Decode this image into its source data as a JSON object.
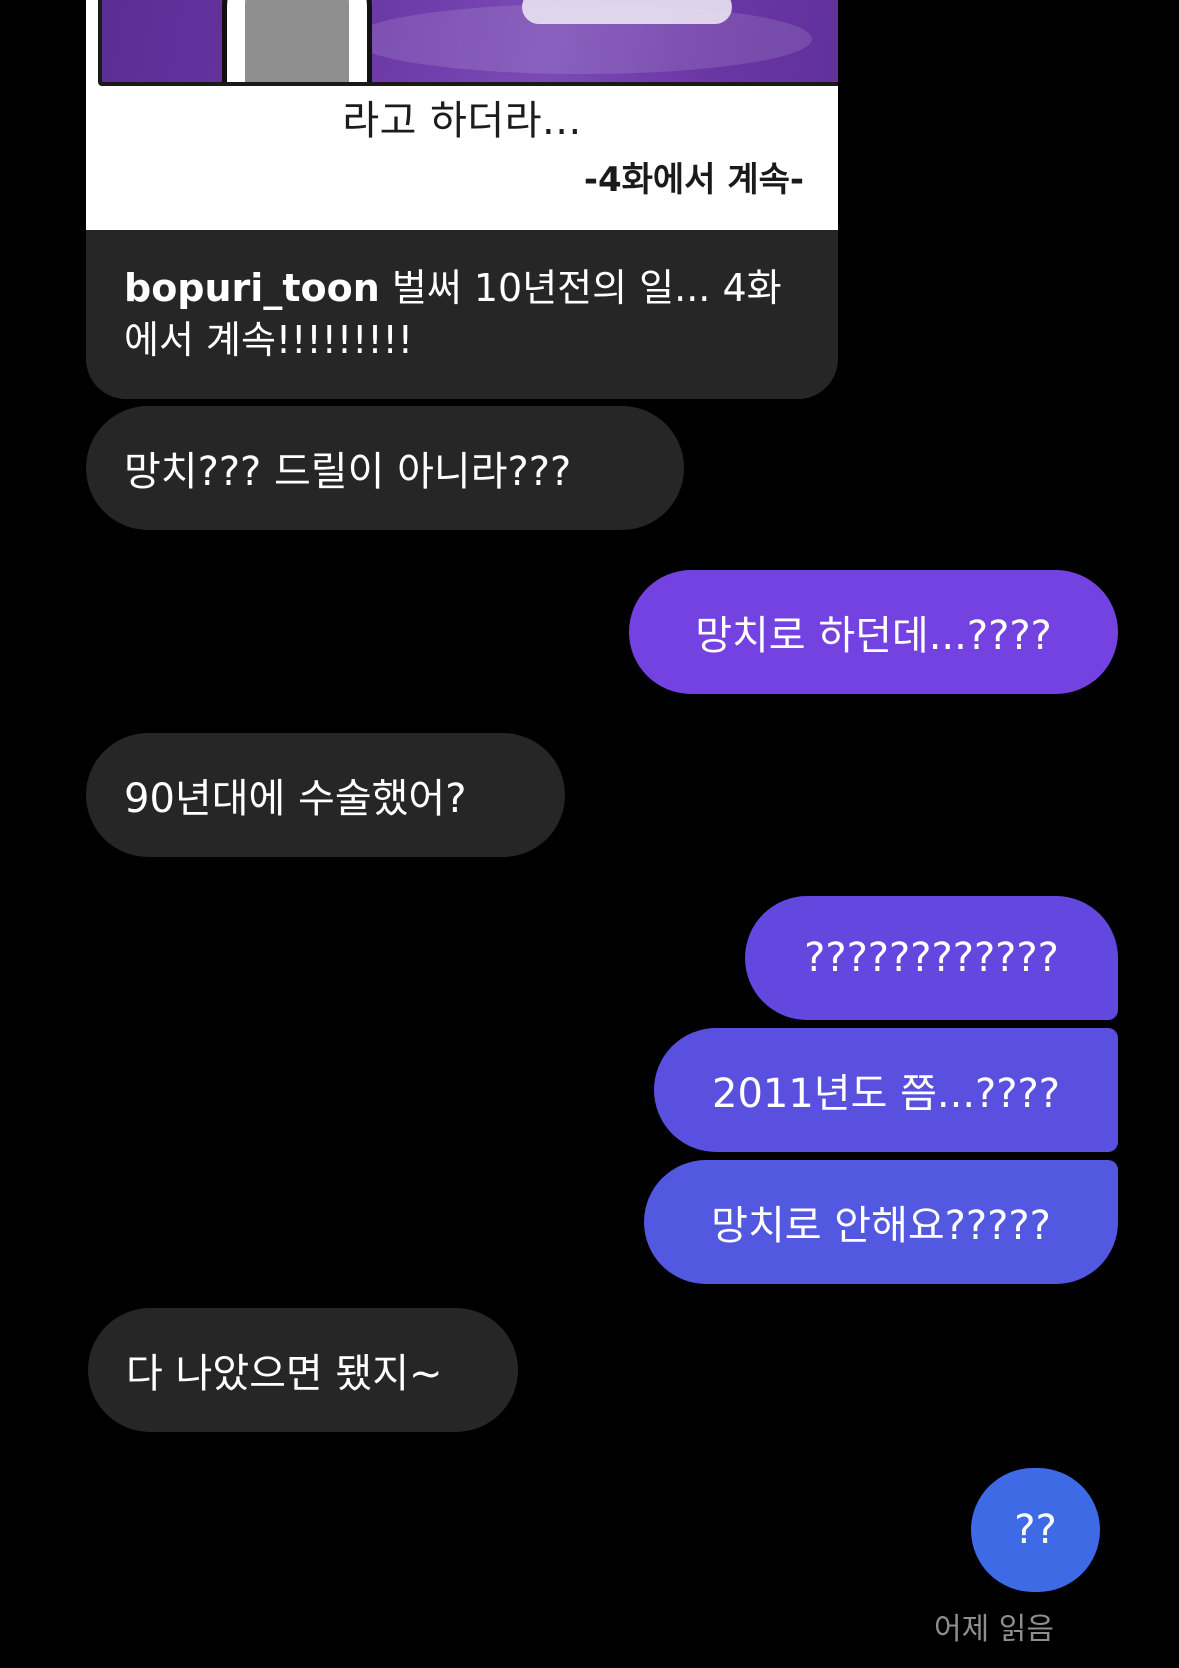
{
  "post": {
    "image_caption": "라고 하더라...",
    "image_continue": "-4화에서 계속-",
    "username": "bopuri_toon",
    "caption": "벌써 10년전의 일... 4화에서 계속!!!!!!!!!"
  },
  "messages": [
    {
      "text": "망치??? 드릴이 아니라???",
      "direction": "incoming"
    },
    {
      "text": "망치로 하던데...????",
      "direction": "outgoing"
    },
    {
      "text": "90년대에 수술했어?",
      "direction": "incoming"
    },
    {
      "text": "????????????",
      "direction": "outgoing"
    },
    {
      "text": "2011년도 쯤...????",
      "direction": "outgoing"
    },
    {
      "text": "망치로 안해요?????",
      "direction": "outgoing"
    },
    {
      "text": "다 나았으면 됐지~",
      "direction": "incoming"
    },
    {
      "text": "??",
      "direction": "outgoing"
    }
  ],
  "read_status": "어제 읽음",
  "colors": {
    "background": "#000000",
    "incoming_bubble": "#262626",
    "outgoing_purple": "#7442e0",
    "outgoing_indigo": "#5358e0",
    "outgoing_blue": "#3f6ae6",
    "read_status": "#8e8e8e"
  }
}
